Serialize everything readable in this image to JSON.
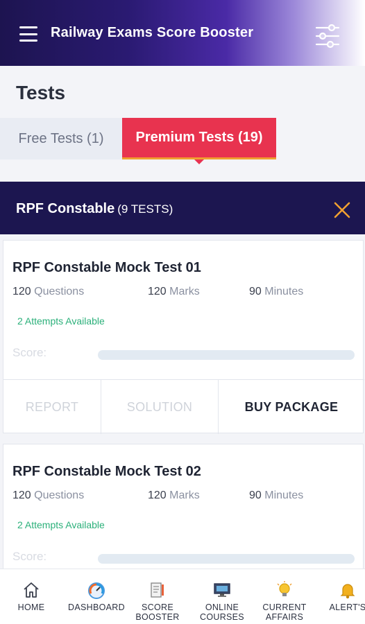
{
  "header": {
    "title": "Railway Exams Score Booster",
    "menu_icon": "hamburger-menu-icon",
    "filter_icon": "filter-sliders-icon",
    "gradient_start": "#1d1450",
    "gradient_end": "#ffffff"
  },
  "page": {
    "title": "Tests"
  },
  "tabs": [
    {
      "label": "Free Tests (1)",
      "active": false
    },
    {
      "label": "Premium Tests (19)",
      "active": true,
      "color": "#e8334f"
    }
  ],
  "section": {
    "name": "RPF Constable",
    "count": "(9 TESTS)",
    "close_icon": "close-x-icon",
    "close_color": "#f0a030"
  },
  "tests": [
    {
      "title": "RPF Constable Mock Test 01",
      "questions_value": "120",
      "questions_label": "Questions",
      "marks_value": "120",
      "marks_label": "Marks",
      "minutes_value": "90",
      "minutes_label": "Minutes",
      "attempts": "2 Attempts Available",
      "score_label": "Score:",
      "actions": {
        "report": "REPORT",
        "solution": "SOLUTION",
        "buy": "BUY PACKAGE"
      }
    },
    {
      "title": "RPF Constable Mock Test 02",
      "questions_value": "120",
      "questions_label": "Questions",
      "marks_value": "120",
      "marks_label": "Marks",
      "minutes_value": "90",
      "minutes_label": "Minutes",
      "attempts": "2 Attempts Available",
      "score_label": "Score:"
    }
  ],
  "bottom_nav": [
    {
      "line1": "HOME",
      "line2": "",
      "icon": "home-icon"
    },
    {
      "line1": "DASHBOARD",
      "line2": "",
      "icon": "gauge-icon"
    },
    {
      "line1": "SCORE",
      "line2": "BOOSTER",
      "icon": "score-booster-icon"
    },
    {
      "line1": "ONLINE",
      "line2": "COURSES",
      "icon": "monitor-icon"
    },
    {
      "line1": "CURRENT",
      "line2": "AFFAIRS",
      "icon": "lightbulb-icon"
    },
    {
      "line1": "ALERT'S",
      "line2": "",
      "icon": "bell-icon"
    }
  ]
}
